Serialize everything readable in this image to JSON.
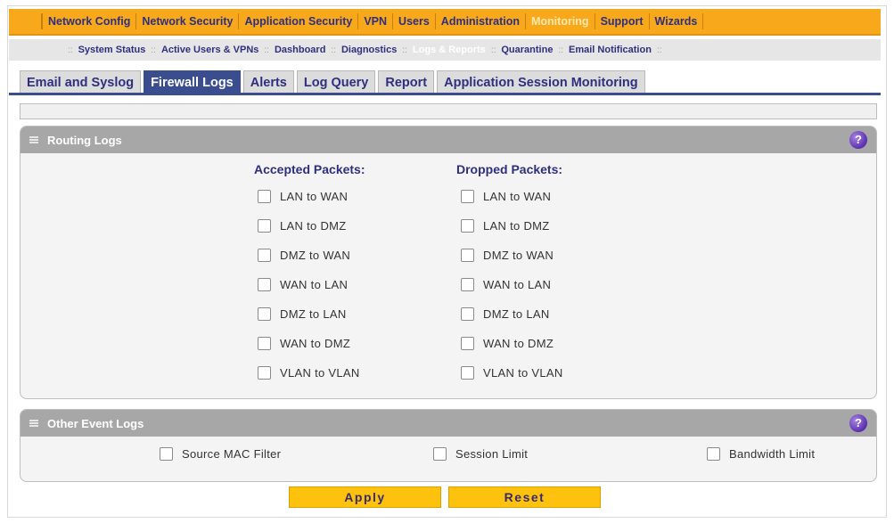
{
  "topnav": {
    "items": [
      "Network Config",
      "Network Security",
      "Application Security",
      "VPN",
      "Users",
      "Administration",
      "Monitoring",
      "Support",
      "Wizards"
    ],
    "active": "Monitoring"
  },
  "subnav": {
    "items": [
      "System Status",
      "Active Users & VPNs",
      "Dashboard",
      "Diagnostics",
      "Logs & Reports",
      "Quarantine",
      "Email Notification"
    ],
    "active": "Logs & Reports"
  },
  "tabs": {
    "items": [
      "Email and Syslog",
      "Firewall Logs",
      "Alerts",
      "Log Query",
      "Report",
      "Application Session Monitoring"
    ],
    "active": "Firewall Logs"
  },
  "routing_logs": {
    "title": "Routing Logs",
    "accepted": {
      "heading": "Accepted Packets:",
      "options": [
        {
          "label": "LAN to WAN",
          "checked": false
        },
        {
          "label": "LAN to DMZ",
          "checked": false
        },
        {
          "label": "DMZ to WAN",
          "checked": false
        },
        {
          "label": "WAN to LAN",
          "checked": false
        },
        {
          "label": "DMZ to LAN",
          "checked": false
        },
        {
          "label": "WAN to DMZ",
          "checked": false
        },
        {
          "label": "VLAN to VLAN",
          "checked": false
        }
      ]
    },
    "dropped": {
      "heading": "Dropped Packets:",
      "options": [
        {
          "label": "LAN to WAN",
          "checked": false
        },
        {
          "label": "LAN to DMZ",
          "checked": false
        },
        {
          "label": "DMZ to WAN",
          "checked": false
        },
        {
          "label": "WAN to LAN",
          "checked": false
        },
        {
          "label": "DMZ to LAN",
          "checked": false
        },
        {
          "label": "WAN to DMZ",
          "checked": false
        },
        {
          "label": "VLAN to VLAN",
          "checked": false
        }
      ]
    }
  },
  "other_event_logs": {
    "title": "Other Event Logs",
    "options": [
      {
        "label": "Source MAC Filter",
        "checked": false
      },
      {
        "label": "Session Limit",
        "checked": false
      },
      {
        "label": "Bandwidth Limit",
        "checked": false
      }
    ]
  },
  "buttons": {
    "apply": "Apply",
    "reset": "Reset"
  },
  "icons": {
    "help": "help-icon",
    "panel_grip": "grip-icon",
    "help_glyph": "?"
  },
  "colors": {
    "topnav_bg": "#f7a81b",
    "tab_active": "#3a4d8f",
    "button_bg": "#fdc20d",
    "help_icon": "#5c2eb0"
  }
}
